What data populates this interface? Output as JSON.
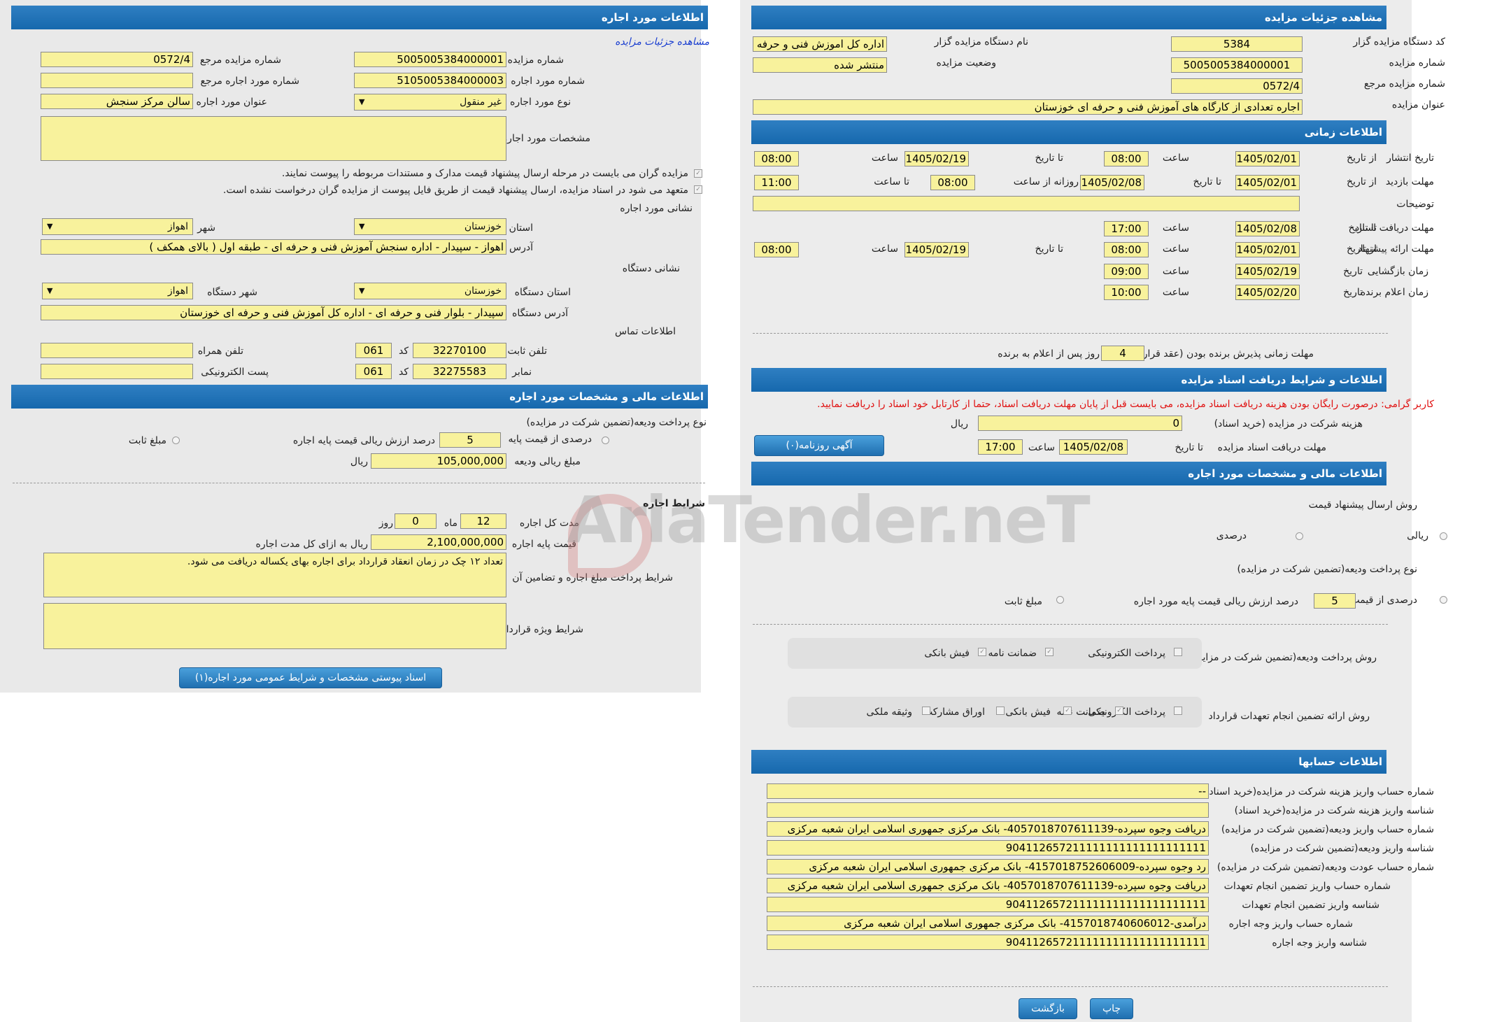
{
  "right": {
    "title": "مشاهده جزئیات مزایده",
    "code_label": "کد دستگاه مزایده گزار",
    "code_value": "5384",
    "org_label": "نام دستگاه مزایده گزار",
    "org_value": "اداره کل اموزش فنی و حرفه",
    "auction_no_label": "شماره مزایده",
    "auction_no_value": "5005005384000001",
    "status_label": "وضعیت مزایده",
    "status_value": "منتشر شده",
    "ref_label": "شماره مزایده مرجع",
    "ref_value": "0572/4",
    "subject_label": "عنوان مزایده",
    "subject_value": "اجاره تعدادی از کارگاه های آموزش فنی و حرفه ای خوزستان",
    "time_title": "اطلاعات زمانی",
    "publish_label": "تاریخ انتشار",
    "from_date": "از تاریخ",
    "to_date": "تا تاریخ",
    "hour": "ساعت",
    "to_hour": "تا ساعت",
    "daily_from": "روزانه از ساعت",
    "publish_from": "1405/02/01",
    "publish_from_time": "08:00",
    "publish_to": "1405/02/19",
    "publish_to_time": "08:00",
    "visit_label": "مهلت بازدید",
    "visit_from": "1405/02/01",
    "visit_to": "1405/02/08",
    "visit_time_from": "08:00",
    "visit_time_to": "11:00",
    "desc_label": "توضیحات",
    "desc_value": "",
    "docs_deadline_label": "مهلت دریافت اسناد",
    "docs_to": "1405/02/08",
    "docs_time": "17:00",
    "offer_deadline_label": "مهلت ارائه پیشنهاد",
    "offer_from": "1405/02/01",
    "offer_from_time": "08:00",
    "offer_to": "1405/02/19",
    "offer_to_time": "08:00",
    "opening_label": "زمان بازگشایی",
    "date_label": "تاریخ",
    "opening_date": "1405/02/19",
    "opening_time": "09:00",
    "winner_label": "زمان اعلام برنده",
    "winner_date": "1405/02/20",
    "winner_time": "10:00",
    "accept_label": "مهلت زمانی پذیرش برنده بودن (عقد قرارداد)",
    "accept_value": "4",
    "accept_suffix": "روز پس از اعلام به برنده",
    "docs_title": "اطلاعات و شرایط دریافت اسناد مزایده",
    "warning": "کاربر گرامی: درصورت رایگان بودن هزینه دریافت اسناد مزایده، می بایست قبل از پایان مهلت دریافت اسناد، حتما از کارتابل خود اسناد را دریافت نمایید.",
    "fee_label": "هزینه شرکت در مزایده (خرید اسناد)",
    "fee_value": "0",
    "rial": "ریال",
    "docs_dl_label": "مهلت دریافت اسناد مزایده",
    "docs_dl_to": "1405/02/08",
    "docs_dl_time": "17:00",
    "newspaper_btn": "آگهی روزنامه(۰)",
    "fin_title": "اطلاعات مالی و مشخصات مورد اجاره",
    "offer_method_label": "روش ارسال پیشنهاد قیمت",
    "rial_opt": "ریالی",
    "percent_opt": "درصدی",
    "deposit_type_label": "نوع پرداخت ودیعه(تضمین شرکت در مزایده)",
    "percent_of_base": "درصدی از قیمت پایه",
    "deposit_pct": "5",
    "deposit_pct_suffix": "درصد ارزش ریالی قیمت پایه مورد اجاره",
    "fixed_amount": "مبلغ ثابت",
    "deposit_pay_label": "روش پرداخت ودیعه(تضمین شرکت در مزایده)",
    "pay_options": [
      "پرداخت الکترونیکی",
      "ضمانت نامه",
      "فیش بانکی"
    ],
    "guarantee_label": "روش ارائه تضمین انجام تعهدات قرارداد",
    "guarantee_options": [
      "پرداخت الکترونیکی",
      "ضمانت نامه",
      "فیش بانکی",
      "اوراق مشارکت",
      "وثیقه ملکی"
    ],
    "acc_title": "اطلاعات حسابها",
    "accounts": [
      {
        "label": "شماره حساب واریز هزینه شرکت در مزایده(خرید اسناد)",
        "value": "--"
      },
      {
        "label": "شناسه واریز هزینه شرکت در مزایده(خرید اسناد)",
        "value": ""
      },
      {
        "label": "شماره حساب واریز ودیعه(تضمین شرکت در مزایده)",
        "value": "دریافت وجوه سپرده-4057018707611139- بانک مرکزی جمهوری اسلامی ایران شعبه مرکزی"
      },
      {
        "label": "شناسه واریز ودیعه(تضمین شرکت در مزایده)",
        "value": "904112657211111111111111111111"
      },
      {
        "label": "شماره حساب عودت ودیعه(تضمین شرکت در مزایده)",
        "value": "رد وجوه سپرده-4157018752606009- بانک مرکزی جمهوری اسلامی ایران شعبه مرکزی"
      },
      {
        "label": "شماره حساب واریز تضمین انجام تعهدات",
        "value": "دریافت وجوه سپرده-4057018707611139- بانک مرکزی جمهوری اسلامی ایران شعبه مرکزی"
      },
      {
        "label": "شناسه واریز تضمین انجام تعهدات",
        "value": "904112657211111111111111111111"
      },
      {
        "label": "شماره حساب واریز وجه اجاره",
        "value": "درآمدی-4157018740606012- بانک مرکزی جمهوری اسلامی ایران شعبه مرکزی"
      },
      {
        "label": "شناسه واریز وجه اجاره",
        "value": "904112657211111111111111111111"
      }
    ],
    "print_btn": "چاپ",
    "back_btn": "بازگشت"
  },
  "left": {
    "title": "اطلاعات مورد اجاره",
    "details_link": "مشاهده جزئیات مزایده",
    "auction_no_label": "شماره مزایده",
    "auction_no_value": "5005005384000001",
    "ref_label": "شماره مزایده مرجع",
    "ref_value": "0572/4",
    "item_no_label": "شماره مورد اجاره",
    "item_no_value": "5105005384000003",
    "item_ref_label": "شماره مورد اجاره مرجع",
    "item_ref_value": "",
    "item_type_label": "نوع مورد اجاره",
    "item_type_value": "غیر منقول",
    "item_title_label": "عنوان مورد اجاره",
    "item_title_value": "سالن مرکز سنجش",
    "spec_label": "مشخصات مورد اجاره",
    "spec_value": "",
    "note1": "مزایده گران می بایست در مرحله ارسال پیشنهاد قیمت مدارک و مستندات مربوطه را پیوست نمایند.",
    "note2": "متعهد می شود در اسناد مزایده، ارسال پیشنهاد قیمت از طریق فایل پیوست از مزایده گران درخواست نشده است.",
    "address_title": "نشانی مورد اجاره",
    "province_label": "استان",
    "province_value": "خوزستان",
    "city_label": "شهر",
    "city_value": "اهواز",
    "address_label": "آدرس",
    "address_value": "اهواز - سپیدار - اداره سنجش آموزش فنی و حرفه ای - طبقه اول ( بالای همکف )",
    "device_title": "نشانی دستگاه",
    "dev_province_label": "استان دستگاه",
    "dev_province_value": "خوزستان",
    "dev_city_label": "شهر دستگاه",
    "dev_city_value": "اهواز",
    "dev_address_label": "آدرس دستگاه",
    "dev_address_value": "سپیدار - بلوار فنی و حرفه ای - اداره کل آموزش فنی و حرفه ای خوزستان",
    "contact_title": "اطلاعات تماس",
    "phone_label": "تلفن ثابت",
    "phone_value": "32270100",
    "code_label": "کد",
    "phone_code": "061",
    "mobile_label": "تلفن همراه",
    "mobile_value": "",
    "fax_label": "نمابر",
    "fax_value": "32275583",
    "fax_code": "061",
    "email_label": "پست الکترونیکی",
    "email_value": "",
    "fin_title": "اطلاعات مالی و مشخصات مورد اجاره",
    "deposit_type_label": "نوع پرداخت ودیعه(تضمین شرکت در مزایده)",
    "percent_of_base": "درصدی از قیمت پایه",
    "deposit_pct": "5",
    "deposit_pct_suffix": "درصد ارزش ریالی قیمت پایه اجاره",
    "fixed_amount": "مبلغ ثابت",
    "deposit_amount_label": "مبلغ ریالی ودیعه",
    "deposit_amount_value": "105,000,000",
    "rial": "ریال",
    "lease_title": "شرایط اجاره",
    "duration_label": "مدت کل اجاره",
    "months_value": "12",
    "month_label": "ماه",
    "days_value": "0",
    "day_label": "روز",
    "base_price_label": "قیمت پایه اجاره",
    "base_price_value": "2,100,000,000",
    "base_price_suffix": "ریال به ازای کل مدت اجاره",
    "payment_terms_label": "شرایط پرداخت مبلغ اجاره و تضامین آن",
    "payment_terms_value": "تعداد ۱۲ چک در زمان انعقاد قرارداد برای اجاره بهای یکساله دریافت می شود.",
    "special_terms_label": "شرایط ویژه قرارداد",
    "special_terms_value": "",
    "attach_btn": "اسناد پیوستی مشخصات و شرایط عمومی مورد اجاره(۱)"
  },
  "watermark": "AriaTender.neT"
}
